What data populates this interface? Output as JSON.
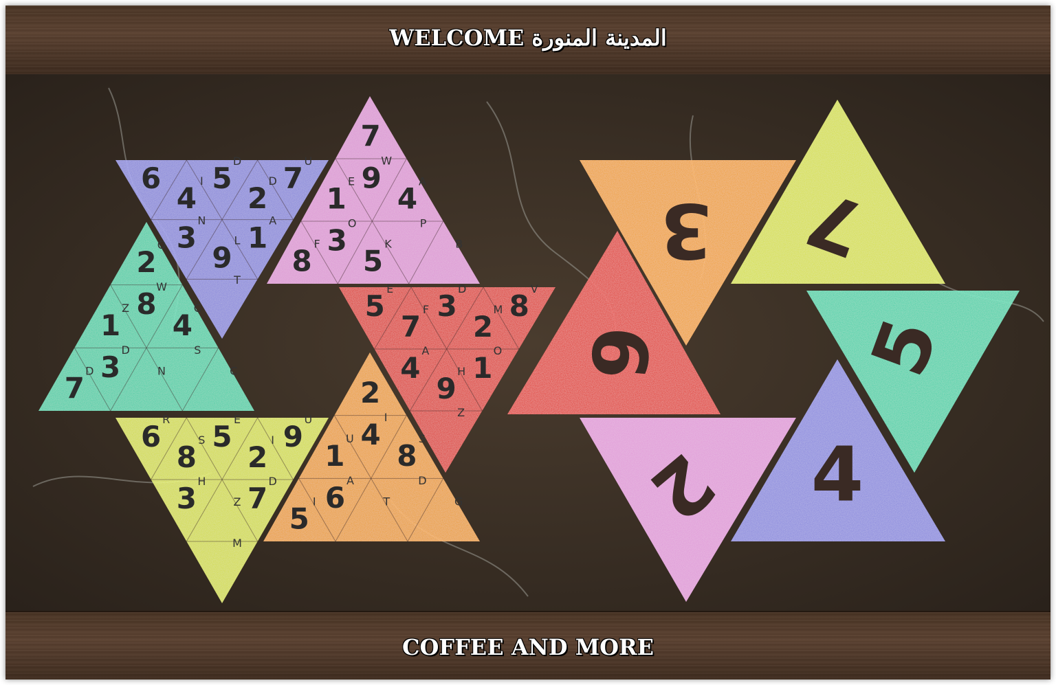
{
  "banner_top": {
    "welcome": "WELCOME",
    "city": "المدينة المنورة"
  },
  "banner_bottom": {
    "tagline": "COFFEE AND MORE"
  },
  "colors": {
    "violet": "#8f8ff0",
    "pink": "#f0a0e8",
    "teal": "#3fe0b4",
    "red": "#f02818",
    "orange": "#ffa818",
    "yellow": "#e4f040",
    "wall": "#3b3026",
    "plank": "#4c3626"
  },
  "puzzle_pieces": [
    {
      "id": "violet",
      "color": "violet",
      "digits": [
        "6",
        "5",
        "4",
        "3",
        "7",
        "2",
        "1",
        "9"
      ],
      "letters": [
        "D",
        "I",
        "N",
        "U",
        "D",
        "A",
        "L",
        "T"
      ]
    },
    {
      "id": "pink",
      "color": "pink",
      "digits": [
        "7",
        "1",
        "9",
        "4",
        "8",
        "3",
        "5"
      ],
      "letters": [
        "E",
        "W",
        "A",
        "F",
        "O",
        "K",
        "P",
        "B"
      ]
    },
    {
      "id": "teal",
      "color": "teal",
      "digits": [
        "2",
        "1",
        "8",
        "4",
        "7",
        "3"
      ],
      "letters": [
        "Z",
        "W",
        "C",
        "D",
        "D",
        "N",
        "S",
        "C",
        "O"
      ]
    },
    {
      "id": "red",
      "color": "red",
      "digits": [
        "5",
        "3",
        "7",
        "4",
        "8",
        "2",
        "1",
        "9"
      ],
      "letters": [
        "D",
        "F",
        "A",
        "V",
        "M",
        "O",
        "H",
        "Z",
        "E",
        "D"
      ]
    },
    {
      "id": "yellow",
      "color": "yellow",
      "digits": [
        "6",
        "5",
        "8",
        "3",
        "9",
        "2",
        "7"
      ],
      "letters": [
        "E",
        "S",
        "H",
        "U",
        "I",
        "D",
        "Z",
        "M",
        "R"
      ]
    },
    {
      "id": "orange",
      "color": "orange",
      "digits": [
        "2",
        "1",
        "4",
        "8",
        "5",
        "6"
      ],
      "letters": [
        "U",
        "I",
        "S",
        "I",
        "A",
        "T",
        "D",
        "G"
      ]
    }
  ],
  "big_tiles": [
    {
      "color": "orange",
      "digit": "3"
    },
    {
      "color": "yellow",
      "digit": "7"
    },
    {
      "color": "red",
      "digit": "6"
    },
    {
      "color": "teal",
      "digit": "5"
    },
    {
      "color": "pink",
      "digit": "2"
    },
    {
      "color": "violet",
      "digit": "4"
    }
  ]
}
